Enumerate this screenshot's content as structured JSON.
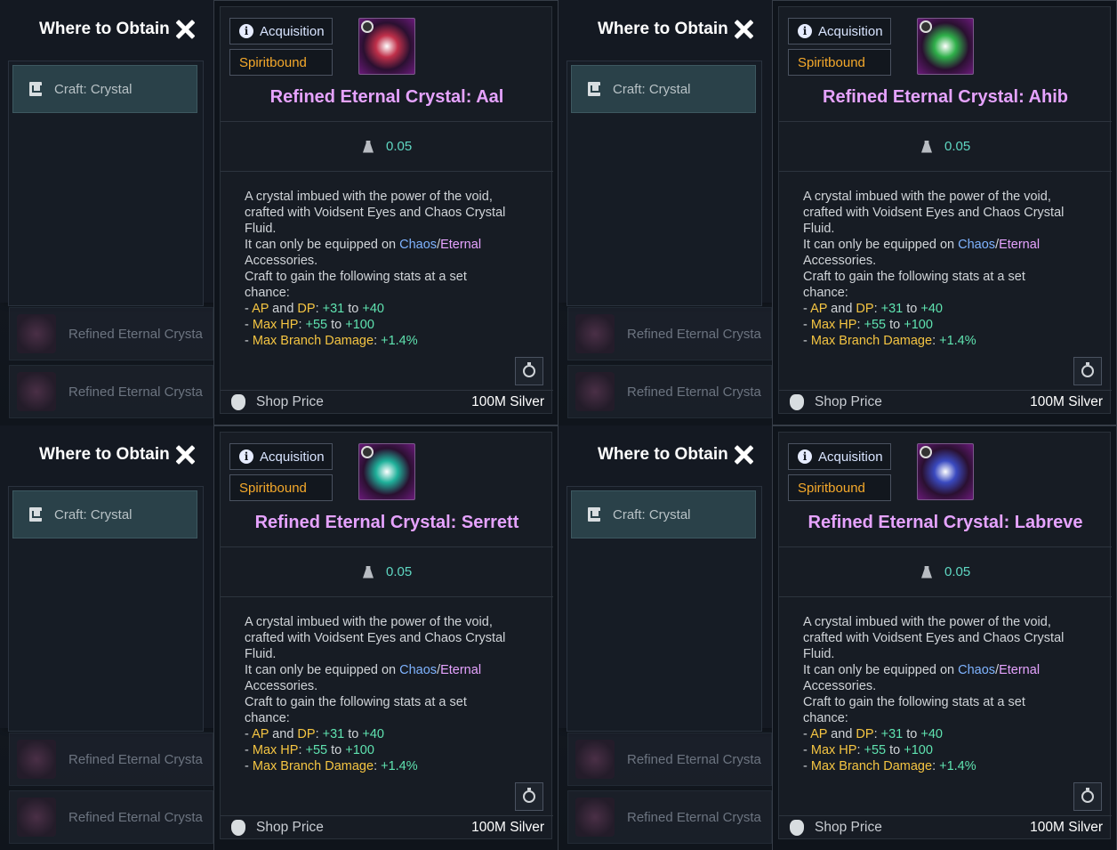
{
  "panels": [
    {
      "where_title": "Where to Obtain",
      "craft_label": "Craft: Crystal",
      "acquisition": "Acquisition",
      "bound": "Spiritbound",
      "name": "Refined Eternal Crystal: Aal",
      "weight": "0.05",
      "crystal_color": "#c0304a",
      "bg_items": [
        "Refined Eternal Crysta",
        "Refined Eternal Crysta"
      ],
      "ghost": "Refined Eternal Crysta"
    },
    {
      "where_title": "Where to Obtain",
      "craft_label": "Craft: Crystal",
      "acquisition": "Acquisition",
      "bound": "Spiritbound",
      "name": "Refined Eternal Crystal: Ahib",
      "weight": "0.05",
      "crystal_color": "#2fb04a",
      "bg_items": [
        "Refined Eternal Crysta",
        "Refined Eternal Crysta"
      ],
      "ghost": "Refined Eternal Crysta"
    },
    {
      "where_title": "Where to Obtain",
      "craft_label": "Craft: Crystal",
      "acquisition": "Acquisition",
      "bound": "Spiritbound",
      "name": "Refined Eternal Crystal: Serrett",
      "weight": "0.05",
      "crystal_color": "#1fb09a",
      "bg_items": [
        "Refined Eternal Crysta",
        "Refined Eternal Crysta"
      ],
      "ghost": "Refined Eternal Crysta"
    },
    {
      "where_title": "Where to Obtain",
      "craft_label": "Craft: Crystal",
      "acquisition": "Acquisition",
      "bound": "Spiritbound",
      "name": "Refined Eternal Crystal: Labreve",
      "weight": "0.05",
      "crystal_color": "#3a4ac0",
      "bg_items": [
        "Refined Eternal Crysta",
        "Refined Eternal Crysta"
      ],
      "ghost": "Refined Eternal Crysta"
    }
  ],
  "description": {
    "line1": "A crystal imbued with the power of the void,",
    "line2": "crafted with Voidsent Eyes and Chaos Crystal",
    "line3": "Fluid.",
    "equip_prefix": "It can only be equipped on ",
    "equip_chaos": "Chaos",
    "equip_slash": "/",
    "equip_eternal": "Eternal",
    "line5": "Accessories.",
    "line6": "Craft to gain the following stats at a set",
    "line7": "chance:",
    "stat1_dash": "- ",
    "stat1_ap": "AP",
    "stat1_and": " and ",
    "stat1_dp": "DP",
    "stat1_colon": ": ",
    "stat1_min": "+31",
    "stat1_to": " to ",
    "stat1_max": "+40",
    "stat2_dash": "- ",
    "stat2_name": "Max HP",
    "stat2_colon": ": ",
    "stat2_min": "+55",
    "stat2_to": " to ",
    "stat2_max": "+100",
    "stat3_dash": "- ",
    "stat3_name": "Max Branch Damage",
    "stat3_colon": ": ",
    "stat3_val": "+1.4%"
  },
  "shop": {
    "label": "Shop Price",
    "price": "100M Silver"
  }
}
